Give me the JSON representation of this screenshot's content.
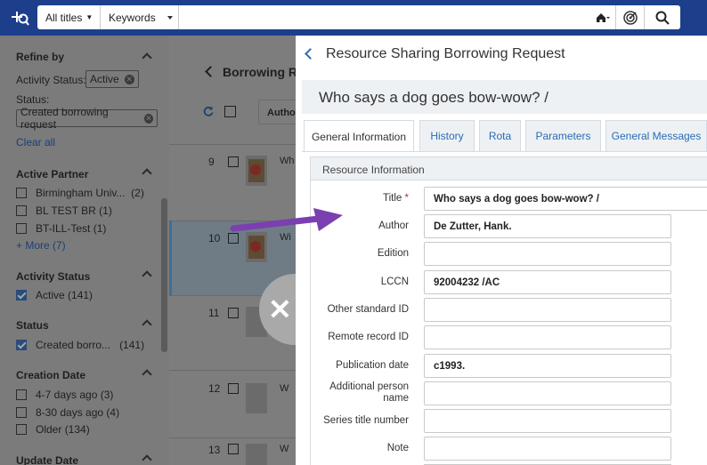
{
  "search": {
    "scope": "All titles",
    "field": "Keywords",
    "query": ""
  },
  "facets": {
    "refine_title": "Refine by",
    "activity_status_label": "Activity Status:",
    "activity_status_value": "Active",
    "status_label": "Status:",
    "status_value": "Created borrowing request",
    "clear_all": "Clear all",
    "active_partner": {
      "title": "Active Partner",
      "items": [
        {
          "label": "Birmingham Univ...",
          "count": "(2)"
        },
        {
          "label": "BL TEST BR",
          "count": "(1)"
        },
        {
          "label": "BT-ILL-Test",
          "count": "(1)"
        }
      ],
      "more": "+ More (7)"
    },
    "activity_status": {
      "title": "Activity Status",
      "items": [
        {
          "label": "Active",
          "count": "(141)"
        }
      ]
    },
    "status": {
      "title": "Status",
      "items": [
        {
          "label": "Created borro...",
          "count": "(141)"
        }
      ]
    },
    "creation_date": {
      "title": "Creation Date",
      "items": [
        {
          "label": "4-7 days ago",
          "count": "(3)"
        },
        {
          "label": "8-30 days ago",
          "count": "(4)"
        },
        {
          "label": "Older",
          "count": "(134)"
        }
      ]
    },
    "update_date": {
      "title": "Update Date"
    }
  },
  "list": {
    "header": "Borrowing Re",
    "rows": [
      {
        "num": "9",
        "title": "Wh"
      },
      {
        "num": "10",
        "title": "Wi"
      },
      {
        "num": "11",
        "title": ""
      },
      {
        "num": "12",
        "title": "W"
      },
      {
        "num": "13",
        "title": "W"
      }
    ]
  },
  "panel": {
    "title": "Resource Sharing Borrowing Request",
    "banner": "Who says a dog goes bow-wow? /",
    "tabs": [
      "General Information",
      "History",
      "Rota",
      "Parameters",
      "General Messages"
    ],
    "active_tab": "General Information",
    "section_title": "Resource Information",
    "fields": [
      {
        "label": "Title",
        "required": "*",
        "value": "Who says a dog goes bow-wow? /"
      },
      {
        "label": "Author",
        "required": "",
        "value": "De Zutter, Hank."
      },
      {
        "label": "Edition",
        "required": "",
        "value": ""
      },
      {
        "label": "LCCN",
        "required": "",
        "value": "92004232 /AC"
      },
      {
        "label": "Other standard ID",
        "required": "",
        "value": ""
      },
      {
        "label": "Remote record ID",
        "required": "",
        "value": ""
      },
      {
        "label": "Publication date",
        "required": "",
        "value": "c1993."
      },
      {
        "label": "Additional person name",
        "required": "",
        "value": ""
      },
      {
        "label": "Series title number",
        "required": "",
        "value": ""
      },
      {
        "label": "Note",
        "required": "",
        "value": ""
      }
    ]
  },
  "colors": {
    "topbar": "#1d3e8a",
    "accent": "#2a6bb3",
    "arrow": "#7b3fb0"
  }
}
